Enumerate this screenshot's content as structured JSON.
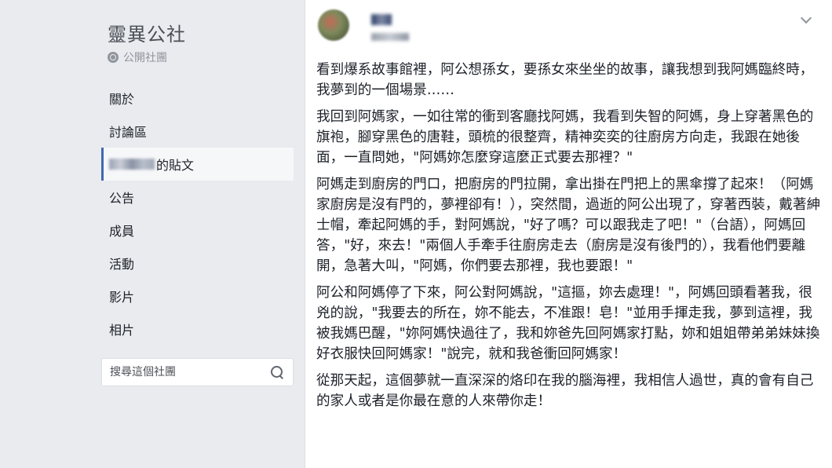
{
  "sidebar": {
    "group_name": "靈異公社",
    "privacy": "公開社團",
    "items": [
      {
        "label": "關於",
        "active": false
      },
      {
        "label": "討論區",
        "active": false
      },
      {
        "label": "的貼文",
        "active": true
      },
      {
        "label": "公告",
        "active": false
      },
      {
        "label": "成員",
        "active": false
      },
      {
        "label": "活動",
        "active": false
      },
      {
        "label": "影片",
        "active": false
      },
      {
        "label": "相片",
        "active": false
      }
    ],
    "search_placeholder": "搜尋這個社團"
  },
  "post": {
    "paragraphs": [
      "看到爆系故事館裡，阿公想孫女，要孫女來坐坐的故事，讓我想到我阿媽臨終時，我夢到的一個場景……",
      "我回到阿媽家，一如往常的衝到客廳找阿媽，我看到失智的阿媽，身上穿著黑色的旗袍，腳穿黑色的唐鞋，頭梳的很整齊，精神奕奕的往廚房方向走，我跟在她後面，一直問她，\"阿媽妳怎麼穿這麼正式要去那裡？\"",
      "阿媽走到廚房的門口，把廚房的門拉開，拿出掛在門把上的黑傘撐了起來！（阿媽家廚房是沒有門的，夢裡卻有！），突然間，過逝的阿公出現了，穿著西裝，戴著紳士帽，牽起阿媽的手，對阿媽說，\"好了嗎？可以跟我走了吧！\"（台語），阿媽回答，\"好，來去！\"兩個人手牽手往廚房走去（廚房是沒有後門的），我看他們要離開，急著大叫，\"阿媽，你們要去那裡，我也要跟！\"",
      "阿公和阿媽停了下來，阿公對阿媽說，\"這摳，妳去處理！\"，阿媽回頭看著我，很兇的說，\"我要去的所在，妳不能去，不准跟！皂！\"並用手揮走我，夢到這裡，我被我媽巴醒，\"妳阿媽快過往了，我和妳爸先回阿媽家打點，妳和姐姐帶弟弟妹妹換好衣服快回阿媽家！\"說完，就和我爸衝回阿媽家！",
      "從那天起，這個夢就一直深深的烙印在我的腦海裡，我相信人過世，真的會有自己的家人或者是你最在意的人來帶你走！"
    ]
  }
}
